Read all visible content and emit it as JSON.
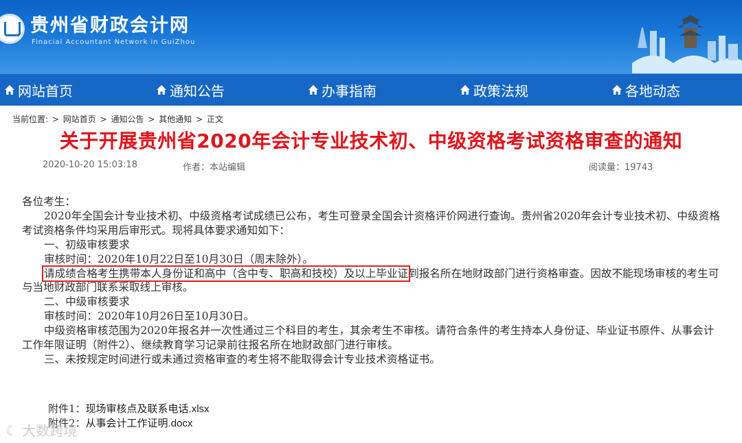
{
  "header": {
    "site_title": "贵州省财政会计网",
    "site_subtitle": "Finacial   Accountant Network in GuiZhou"
  },
  "nav": [
    {
      "label": "网站首页",
      "icon": "home-icon"
    },
    {
      "label": "通知公告",
      "icon": "home-icon"
    },
    {
      "label": "办事指南",
      "icon": "home-icon"
    },
    {
      "label": "政策法规",
      "icon": "home-icon"
    },
    {
      "label": "各地动态",
      "icon": "home-icon"
    }
  ],
  "breadcrumb": {
    "prefix": "当前位置:",
    "items": [
      "网站首页",
      "通知公告",
      "其他通知",
      "正文"
    ],
    "separator": ">"
  },
  "article": {
    "title": "关于开展贵州省2020年会计专业技术初、中级资格考试资格审查的通知",
    "date": "2020-10-20 15:03:18",
    "author": "作者：本站编辑",
    "views": "阅读量：19743",
    "paragraphs": {
      "greeting": "各位考生：",
      "p1": "2020年全国会计专业技术初、中级资格考试成绩已公布，考生可登录全国会计资格评价网进行查询。贵州省2020年会计专业技术初、中级资格考试资格条件均采用后审形式。现将具体要求通知如下：",
      "h1": "一、初级审核要求",
      "t1": "审核时间：2020年10月22日至10月30日（周末除外）。",
      "p2_highlight": "请成绩合格考生携带本人身份证和高中（含中专、职高和技校）及以上毕业证",
      "p2_rest": "到报名所在地财政部门进行资格审查。因故不能现场审核的考生可与当地财政部门联系采取线上审核。",
      "h2": "二、中级审核要求",
      "t2": "审核时间：2020年10月26日至10月30日。",
      "p3": "中级资格审核范围为2020年报名并一次性通过三个科目的考生，其余考生不审核。请符合条件的考生持本人身份证、毕业证书原件、从事会计工作年限证明（附件2）、继续教育学习记录前往报名所在地财政部门进行审核。",
      "h3": "三、未按规定时间进行或未通过资格审查的考生将不能取得会计专业技术资格证书。"
    },
    "attachments": [
      {
        "label": "附件1：",
        "name": "现场审核点及联系电话.xlsx"
      },
      {
        "label": "附件2：",
        "name": "从事会计工作证明.docx"
      }
    ]
  },
  "watermark": "大数跨境",
  "colors": {
    "header_blue": "#1877d8",
    "nav_blue": "#1667c5",
    "title_red": "#e0141b",
    "highlight_red": "#e02020"
  }
}
